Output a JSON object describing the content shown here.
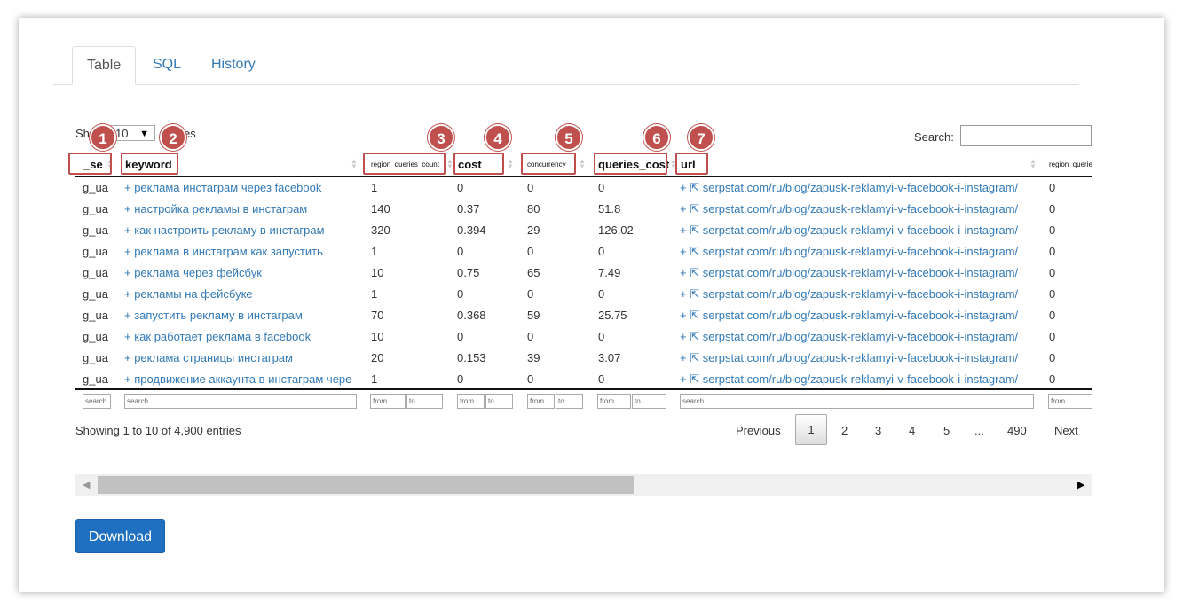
{
  "tabs": [
    {
      "label": "Table",
      "active": true
    },
    {
      "label": "SQL",
      "active": false
    },
    {
      "label": "History",
      "active": false
    }
  ],
  "length_menu": {
    "prefix": "Sh",
    "value": "10",
    "suffix": "es"
  },
  "search_label": "Search:",
  "columns": [
    "_se",
    "keyword",
    "region_queries_count",
    "cost",
    "concurrency",
    "queries_cost",
    "url",
    "region_querie"
  ],
  "badges": [
    "1",
    "2",
    "3",
    "4",
    "5",
    "6",
    "7"
  ],
  "rows": [
    {
      "se": "g_ua",
      "keyword": "+ реклама инстаграм через facebook",
      "rqc": "1",
      "cost": "0",
      "conc": "0",
      "qcost": "0",
      "url": "+ ⇱ serpstat.com/ru/blog/zapusk-reklamyi-v-facebook-i-instagram/",
      "extra": "0"
    },
    {
      "se": "g_ua",
      "keyword": "+ настройка рекламы в инстаграм",
      "rqc": "140",
      "cost": "0.37",
      "conc": "80",
      "qcost": "51.8",
      "url": "+ ⇱ serpstat.com/ru/blog/zapusk-reklamyi-v-facebook-i-instagram/",
      "extra": "0"
    },
    {
      "se": "g_ua",
      "keyword": "+ как настроить рекламу в инстаграм",
      "rqc": "320",
      "cost": "0.394",
      "conc": "29",
      "qcost": "126.02",
      "url": "+ ⇱ serpstat.com/ru/blog/zapusk-reklamyi-v-facebook-i-instagram/",
      "extra": "0"
    },
    {
      "se": "g_ua",
      "keyword": "+ реклама в инстаграм как запустить",
      "rqc": "1",
      "cost": "0",
      "conc": "0",
      "qcost": "0",
      "url": "+ ⇱ serpstat.com/ru/blog/zapusk-reklamyi-v-facebook-i-instagram/",
      "extra": "0"
    },
    {
      "se": "g_ua",
      "keyword": "+ реклама через фейсбук",
      "rqc": "10",
      "cost": "0.75",
      "conc": "65",
      "qcost": "7.49",
      "url": "+ ⇱ serpstat.com/ru/blog/zapusk-reklamyi-v-facebook-i-instagram/",
      "extra": "0"
    },
    {
      "se": "g_ua",
      "keyword": "+ рекламы на фейсбуке",
      "rqc": "1",
      "cost": "0",
      "conc": "0",
      "qcost": "0",
      "url": "+ ⇱ serpstat.com/ru/blog/zapusk-reklamyi-v-facebook-i-instagram/",
      "extra": "0"
    },
    {
      "se": "g_ua",
      "keyword": "+ запустить рекламу в инстаграм",
      "rqc": "70",
      "cost": "0.368",
      "conc": "59",
      "qcost": "25.75",
      "url": "+ ⇱ serpstat.com/ru/blog/zapusk-reklamyi-v-facebook-i-instagram/",
      "extra": "0"
    },
    {
      "se": "g_ua",
      "keyword": "+ как работает реклама в facebook",
      "rqc": "10",
      "cost": "0",
      "conc": "0",
      "qcost": "0",
      "url": "+ ⇱ serpstat.com/ru/blog/zapusk-reklamyi-v-facebook-i-instagram/",
      "extra": "0"
    },
    {
      "se": "g_ua",
      "keyword": "+ реклама страницы инстаграм",
      "rqc": "20",
      "cost": "0.153",
      "conc": "39",
      "qcost": "3.07",
      "url": "+ ⇱ serpstat.com/ru/blog/zapusk-reklamyi-v-facebook-i-instagram/",
      "extra": "0"
    },
    {
      "se": "g_ua",
      "keyword": "+ продвижение аккаунта в инстаграм чере",
      "rqc": "1",
      "cost": "0",
      "conc": "0",
      "qcost": "0",
      "url": "+ ⇱ serpstat.com/ru/blog/zapusk-reklamyi-v-facebook-i-instagram/",
      "extra": "0"
    }
  ],
  "filters": {
    "search": "search",
    "from": "from",
    "to": "to"
  },
  "info": "Showing 1 to 10 of 4,900 entries",
  "pagination": {
    "previous": "Previous",
    "pages": [
      "1",
      "2",
      "3",
      "4",
      "5",
      "...",
      "490"
    ],
    "next": "Next",
    "current": "1"
  },
  "download_label": "Download",
  "colors": {
    "link": "#337ab7",
    "badge": "#c0504d",
    "button": "#1f70c1"
  }
}
